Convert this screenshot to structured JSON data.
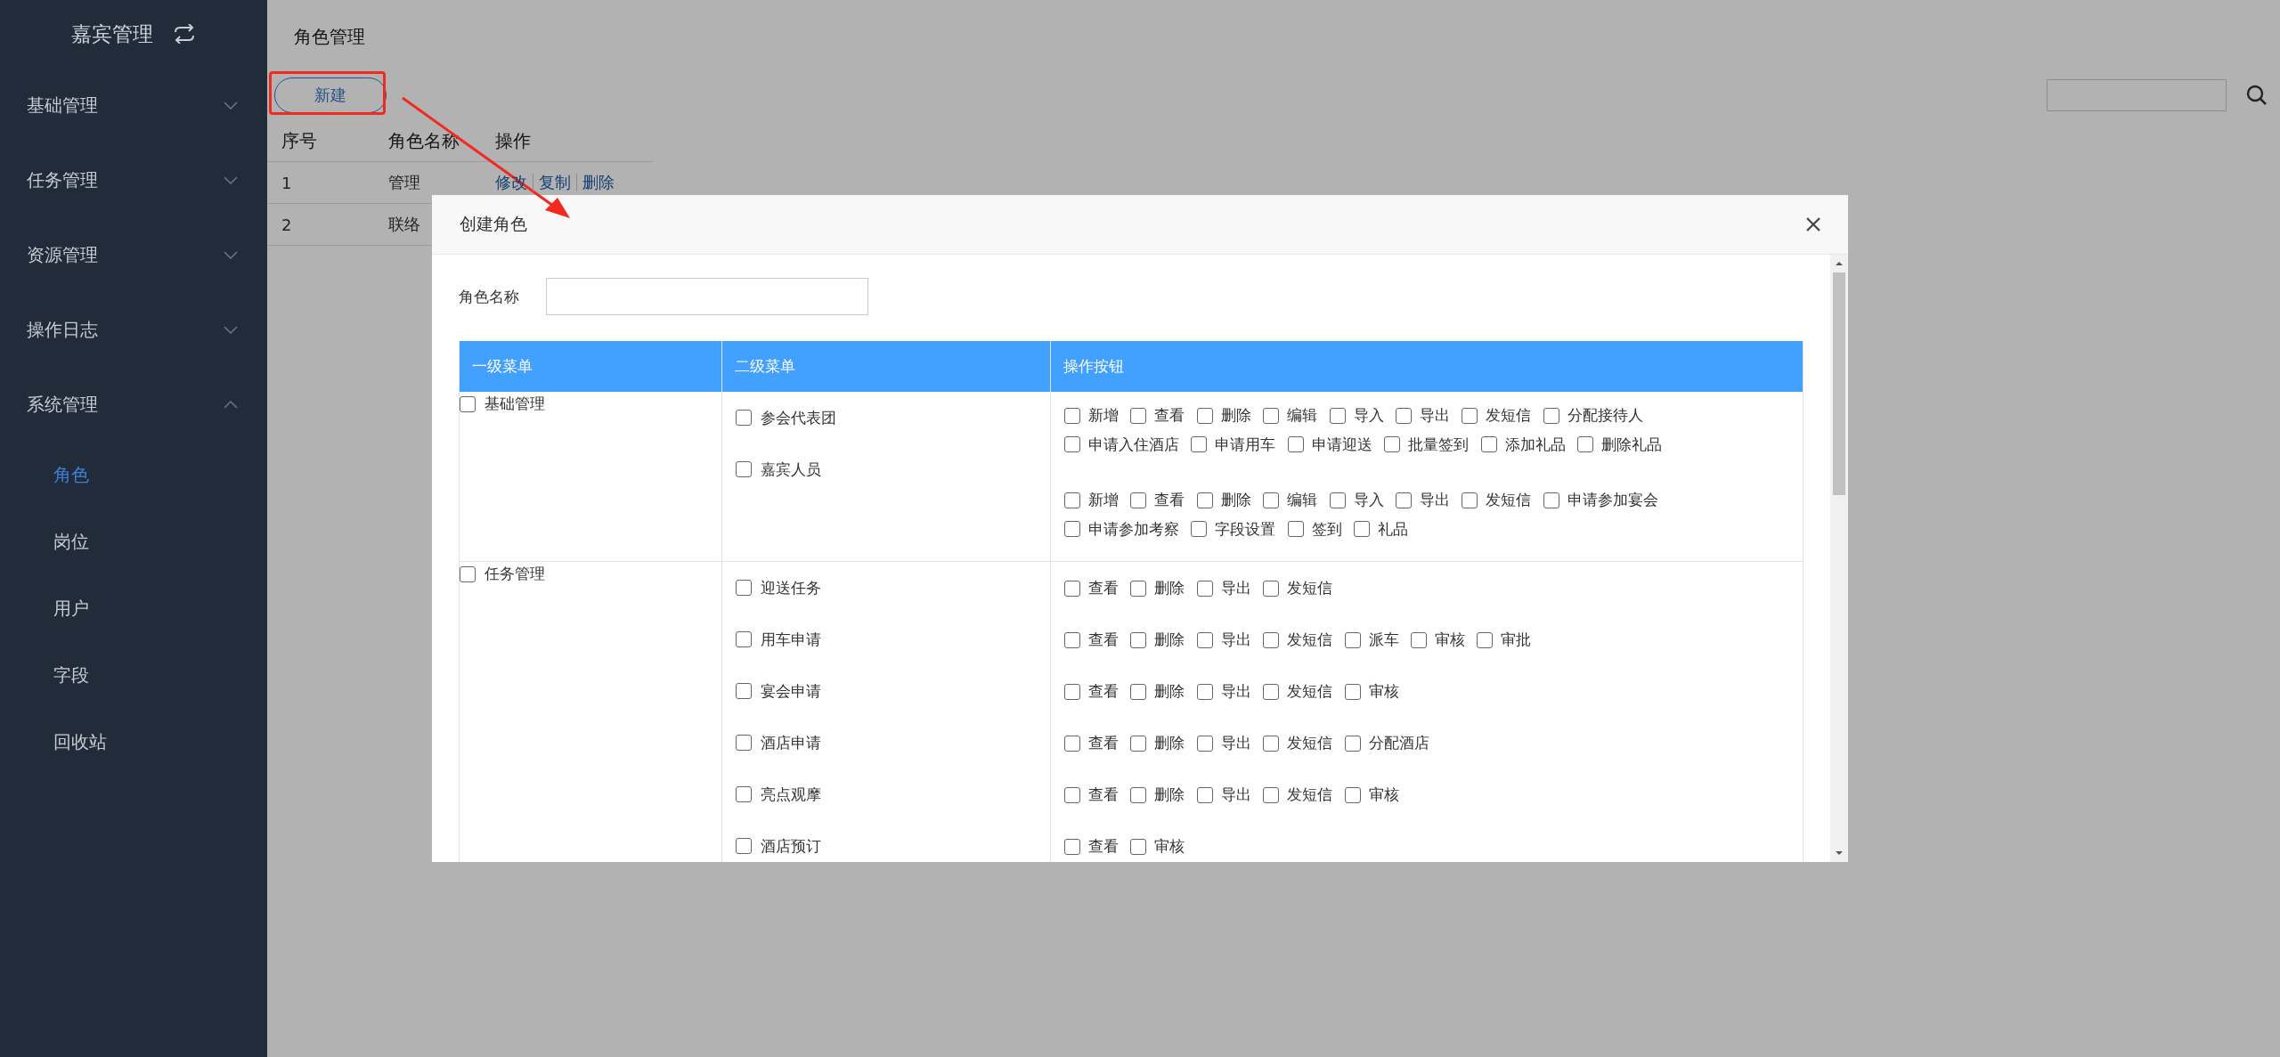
{
  "sidebar": {
    "title": "嘉宾管理",
    "groups": [
      {
        "label": "基础管理",
        "expanded": false
      },
      {
        "label": "任务管理",
        "expanded": false
      },
      {
        "label": "资源管理",
        "expanded": false
      },
      {
        "label": "操作日志",
        "expanded": false
      },
      {
        "label": "系统管理",
        "expanded": true,
        "children": [
          {
            "label": "角色",
            "selected": true
          },
          {
            "label": "岗位",
            "selected": false
          },
          {
            "label": "用户",
            "selected": false
          },
          {
            "label": "字段",
            "selected": false
          },
          {
            "label": "回收站",
            "selected": false
          }
        ]
      }
    ]
  },
  "page": {
    "title": "角色管理",
    "new_button": "新建",
    "columns": [
      "序号",
      "角色名称",
      "操作"
    ],
    "rows": [
      {
        "index": "1",
        "name": "管理",
        "actions": [
          "修改",
          "复制",
          "删除"
        ]
      },
      {
        "index": "2",
        "name": "联络"
      }
    ]
  },
  "dialog": {
    "title": "创建角色",
    "name_label": "角色名称",
    "columns": [
      "一级菜单",
      "二级菜单",
      "操作按钮"
    ],
    "modules": [
      {
        "name": "基础管理",
        "checked": false,
        "submenus": [
          {
            "name": "参会代表团",
            "checked": false,
            "actions": [
              {
                "label": "新增",
                "checked": false
              },
              {
                "label": "查看",
                "checked": false
              },
              {
                "label": "删除",
                "checked": false
              },
              {
                "label": "编辑",
                "checked": false
              },
              {
                "label": "导入",
                "checked": false
              },
              {
                "label": "导出",
                "checked": false
              },
              {
                "label": "发短信",
                "checked": false
              },
              {
                "label": "分配接待人",
                "checked": false
              },
              {
                "label": "申请入住酒店",
                "checked": false
              },
              {
                "label": "申请用车",
                "checked": false
              },
              {
                "label": "申请迎送",
                "checked": false
              },
              {
                "label": "批量签到",
                "checked": false
              },
              {
                "label": "添加礼品",
                "checked": false
              },
              {
                "label": "删除礼品",
                "checked": false
              }
            ]
          },
          {
            "name": "嘉宾人员",
            "checked": false,
            "actions": [
              {
                "label": "新增",
                "checked": false
              },
              {
                "label": "查看",
                "checked": false
              },
              {
                "label": "删除",
                "checked": false
              },
              {
                "label": "编辑",
                "checked": false
              },
              {
                "label": "导入",
                "checked": false
              },
              {
                "label": "导出",
                "checked": false
              },
              {
                "label": "发短信",
                "checked": false
              },
              {
                "label": "申请参加宴会",
                "checked": false
              },
              {
                "label": "申请参加考察",
                "checked": false
              },
              {
                "label": "字段设置",
                "checked": false
              },
              {
                "label": "签到",
                "checked": false
              },
              {
                "label": "礼品",
                "checked": false
              }
            ]
          }
        ]
      },
      {
        "name": "任务管理",
        "checked": false,
        "submenus": [
          {
            "name": "迎送任务",
            "checked": false,
            "actions": [
              {
                "label": "查看",
                "checked": false
              },
              {
                "label": "删除",
                "checked": false
              },
              {
                "label": "导出",
                "checked": false
              },
              {
                "label": "发短信",
                "checked": false
              }
            ]
          },
          {
            "name": "用车申请",
            "checked": false,
            "actions": [
              {
                "label": "查看",
                "checked": false
              },
              {
                "label": "删除",
                "checked": false
              },
              {
                "label": "导出",
                "checked": false
              },
              {
                "label": "发短信",
                "checked": false
              },
              {
                "label": "派车",
                "checked": false
              },
              {
                "label": "审核",
                "checked": false
              },
              {
                "label": "审批",
                "checked": false
              }
            ]
          },
          {
            "name": "宴会申请",
            "checked": false,
            "actions": [
              {
                "label": "查看",
                "checked": false
              },
              {
                "label": "删除",
                "checked": false
              },
              {
                "label": "导出",
                "checked": false
              },
              {
                "label": "发短信",
                "checked": false
              },
              {
                "label": "审核",
                "checked": false
              }
            ]
          },
          {
            "name": "酒店申请",
            "checked": false,
            "actions": [
              {
                "label": "查看",
                "checked": false
              },
              {
                "label": "删除",
                "checked": false
              },
              {
                "label": "导出",
                "checked": false
              },
              {
                "label": "发短信",
                "checked": false
              },
              {
                "label": "分配酒店",
                "checked": false
              }
            ]
          },
          {
            "name": "亮点观摩",
            "checked": false,
            "actions": [
              {
                "label": "查看",
                "checked": false
              },
              {
                "label": "删除",
                "checked": false
              },
              {
                "label": "导出",
                "checked": false
              },
              {
                "label": "发短信",
                "checked": false
              },
              {
                "label": "审核",
                "checked": false
              }
            ]
          },
          {
            "name": "酒店预订",
            "checked": false,
            "actions": [
              {
                "label": "查看",
                "checked": false
              },
              {
                "label": "审核",
                "checked": false
              }
            ]
          }
        ]
      }
    ]
  }
}
